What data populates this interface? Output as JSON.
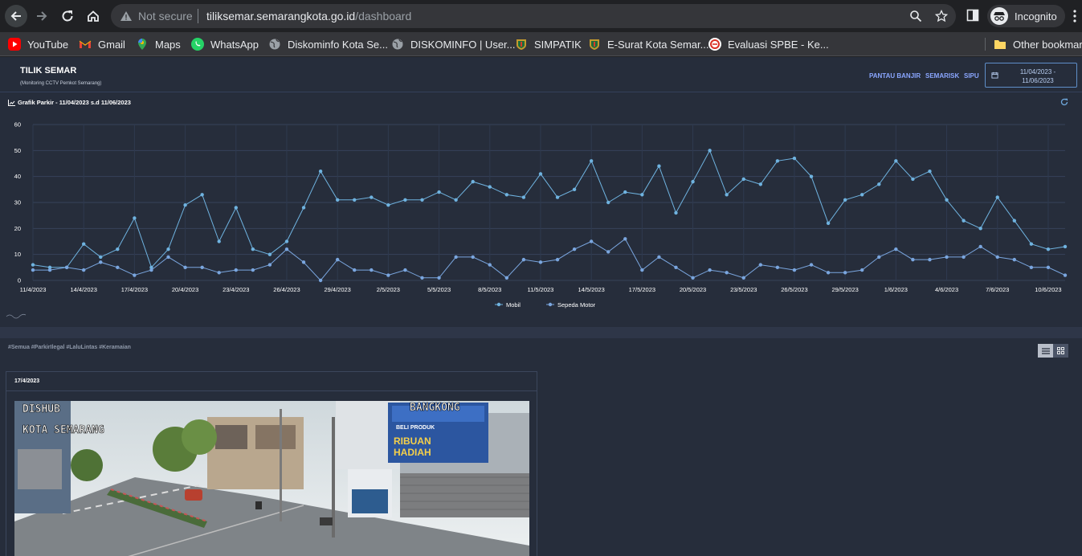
{
  "browser": {
    "not_secure": "Not secure",
    "url_host": "tiliksemar.semarangkota.go.id",
    "url_path": "/dashboard",
    "profile": "Incognito",
    "bookmarks": [
      {
        "label": "YouTube",
        "icon": "youtube-icon"
      },
      {
        "label": "Gmail",
        "icon": "gmail-icon"
      },
      {
        "label": "Maps",
        "icon": "maps-icon"
      },
      {
        "label": "WhatsApp",
        "icon": "whatsapp-icon"
      },
      {
        "label": "Diskominfo Kota Se...",
        "icon": "globe-icon"
      },
      {
        "label": "DISKOMINFO | User...",
        "icon": "globe-icon"
      },
      {
        "label": "SIMPATIK",
        "icon": "crest-icon"
      },
      {
        "label": "E-Surat Kota Semar...",
        "icon": "crest-icon"
      },
      {
        "label": "Evaluasi SPBE - Ke...",
        "icon": "spbe-icon"
      }
    ],
    "other_bookmarks": "Other bookmarks"
  },
  "header": {
    "title": "TILIK SEMAR",
    "subtitle": "(Monitoring CCTV Pemkot Semarang)",
    "links": [
      "PANTAU BANJIR",
      "SEMARISK",
      "SIPU"
    ],
    "date_range": "11/04/2023 - 11/06/2023"
  },
  "chart_section": {
    "title": "Grafik Parkir - 11/04/2023 s.d 11/06/2023"
  },
  "tags": "#Semua #ParkirIlegal #LaluLintas #Keramaian",
  "cctv": {
    "date": "17/4/2023",
    "overlay_left_line1": "DISHUB",
    "overlay_left_line2": "KOTA SEMARANG",
    "overlay_right": "BANGKONG",
    "billboard_line1": "BELI PRODUK",
    "billboard_line2": "RIBUAN",
    "billboard_line3": "HADIAH"
  },
  "colors": {
    "page_bg": "#262d3b",
    "mobil": "#6fb3e0",
    "motor": "#7aa6df",
    "link": "#8aa6ff"
  },
  "chart_data": {
    "type": "line",
    "title": "",
    "ylim": [
      0,
      60
    ],
    "yticks": [
      0,
      10,
      20,
      30,
      40,
      50,
      60
    ],
    "x_tick_labels": [
      "11/4/2023",
      "14/4/2023",
      "17/4/2023",
      "20/4/2023",
      "23/4/2023",
      "26/4/2023",
      "29/4/2023",
      "2/5/2023",
      "5/5/2023",
      "8/5/2023",
      "11/5/2023",
      "14/5/2023",
      "17/5/2023",
      "20/5/2023",
      "23/5/2023",
      "26/5/2023",
      "29/5/2023",
      "1/6/2023",
      "4/6/2023",
      "7/6/2023",
      "10/6/2023"
    ],
    "legend_position": "bottom",
    "grid": true,
    "series": [
      {
        "name": "Mobil",
        "values": [
          6,
          5,
          5,
          14,
          9,
          12,
          24,
          5,
          12,
          29,
          33,
          15,
          28,
          12,
          10,
          15,
          28,
          42,
          31,
          31,
          32,
          29,
          31,
          31,
          34,
          31,
          38,
          36,
          33,
          32,
          41,
          32,
          35,
          46,
          30,
          34,
          33,
          44,
          26,
          38,
          50,
          33,
          39,
          37,
          46,
          47,
          40,
          22,
          31,
          33,
          37,
          46,
          39,
          42,
          31,
          23,
          20,
          32,
          23,
          14,
          12,
          13
        ]
      },
      {
        "name": "Sepeda Motor",
        "values": [
          4,
          4,
          5,
          4,
          7,
          5,
          2,
          4,
          9,
          5,
          5,
          3,
          4,
          4,
          6,
          12,
          7,
          0,
          8,
          4,
          4,
          2,
          4,
          1,
          1,
          9,
          9,
          6,
          1,
          8,
          7,
          8,
          12,
          15,
          11,
          16,
          4,
          9,
          5,
          1,
          4,
          3,
          1,
          6,
          5,
          4,
          6,
          3,
          3,
          4,
          9,
          12,
          8,
          8,
          9,
          9,
          13,
          9,
          8,
          5,
          5,
          2
        ]
      }
    ]
  }
}
